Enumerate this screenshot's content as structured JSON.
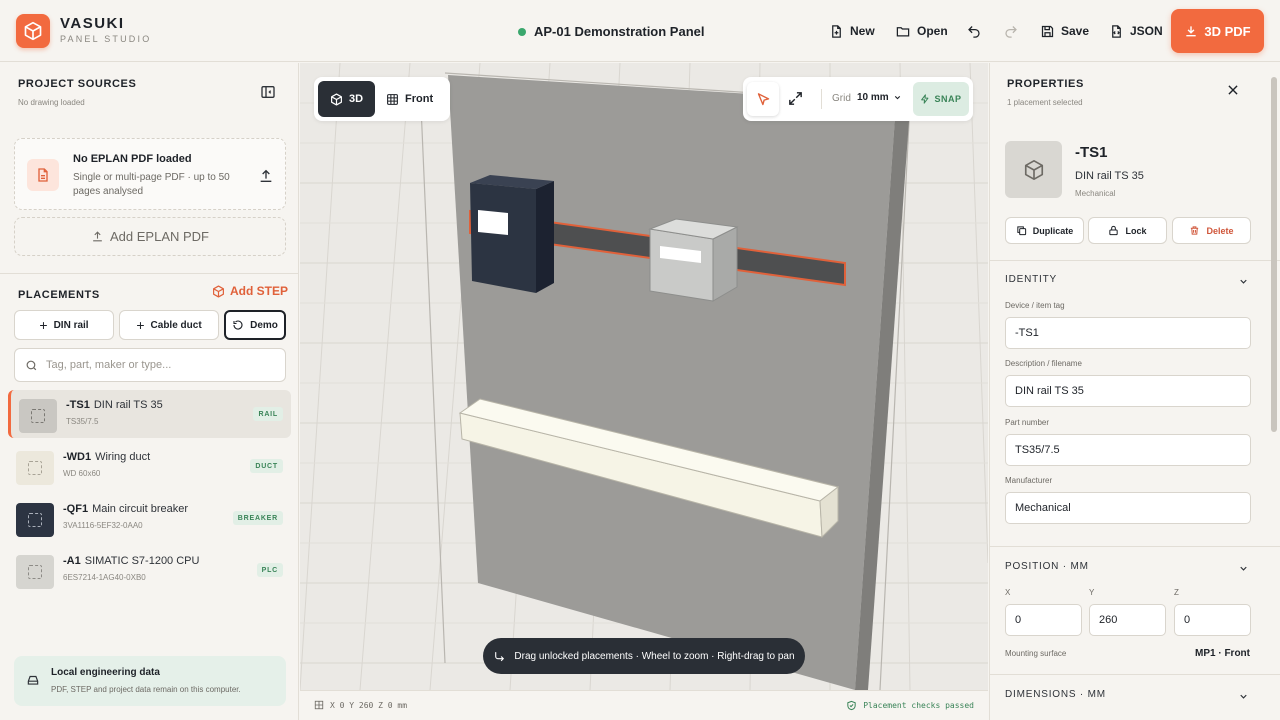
{
  "header": {
    "brand_name": "VASUKI",
    "brand_sub": "PANEL STUDIO",
    "project_title": "AP-01 Demonstration Panel",
    "new_label": "New",
    "open_label": "Open",
    "save_label": "Save",
    "json_label": "JSON",
    "export_label": "3D PDF",
    "status_color": "#3aa76d",
    "accent": "#f26a3f"
  },
  "sources": {
    "title": "PROJECT SOURCES",
    "subtitle": "No drawing loaded",
    "card_title": "No EPLAN PDF loaded",
    "card_desc": "Single or multi-page PDF · up to 50 pages analysed",
    "add_label": "Add EPLAN PDF"
  },
  "placements": {
    "title": "PLACEMENTS",
    "add_step_label": "Add STEP",
    "din_rail_label": "DIN rail",
    "cable_duct_label": "Cable duct",
    "demo_label": "Demo",
    "search_placeholder": "Tag, part, maker or type...",
    "items": [
      {
        "tag": "-TS1",
        "desc": "DIN rail TS 35",
        "part": "TS35/7.5",
        "badge": "RAIL",
        "thumb_color": "#c9c7c2",
        "selected": true
      },
      {
        "tag": "-WD1",
        "desc": "Wiring duct",
        "part": "WD 60x60",
        "badge": "DUCT",
        "thumb_color": "#ece8dc",
        "selected": false
      },
      {
        "tag": "-QF1",
        "desc": "Main circuit breaker",
        "part": "3VA1116-5EF32-0AA0",
        "badge": "BREAKER",
        "thumb_color": "#2c3442",
        "selected": false
      },
      {
        "tag": "-A1",
        "desc": "SIMATIC S7-1200 CPU",
        "part": "6ES7214-1AG40-0XB0",
        "badge": "PLC",
        "thumb_color": "#d6d5d0",
        "selected": false
      }
    ]
  },
  "local": {
    "title": "Local engineering data",
    "desc": "PDF, STEP and project data remain on this computer."
  },
  "viewport": {
    "view_3d_label": "3D",
    "view_front_label": "Front",
    "grid_label": "Grid",
    "grid_value": "10 mm",
    "snap_label": "SNAP",
    "hint": "Drag unlocked placements · Wheel to zoom · Right-drag to pan",
    "coords": "X 0 Y 260 Z 0 mm",
    "checks": "Placement checks passed"
  },
  "properties": {
    "title": "PROPERTIES",
    "subtitle": "1 placement selected",
    "tag": "-TS1",
    "desc": "DIN rail TS 35",
    "category": "Mechanical",
    "duplicate_label": "Duplicate",
    "lock_label": "Lock",
    "delete_label": "Delete",
    "identity_title": "IDENTITY",
    "device_tag_label": "Device / item tag",
    "device_tag": "-TS1",
    "description_label": "Description / filename",
    "description": "DIN rail TS 35",
    "part_number_label": "Part number",
    "part_number": "TS35/7.5",
    "manufacturer_label": "Manufacturer",
    "manufacturer": "Mechanical",
    "position_title": "POSITION · MM",
    "x_label": "X",
    "y_label": "Y",
    "z_label": "Z",
    "x": "0",
    "y": "260",
    "z": "0",
    "mounting_label": "Mounting surface",
    "mounting_value": "MP1 · Front",
    "dimensions_title": "DIMENSIONS · MM"
  }
}
